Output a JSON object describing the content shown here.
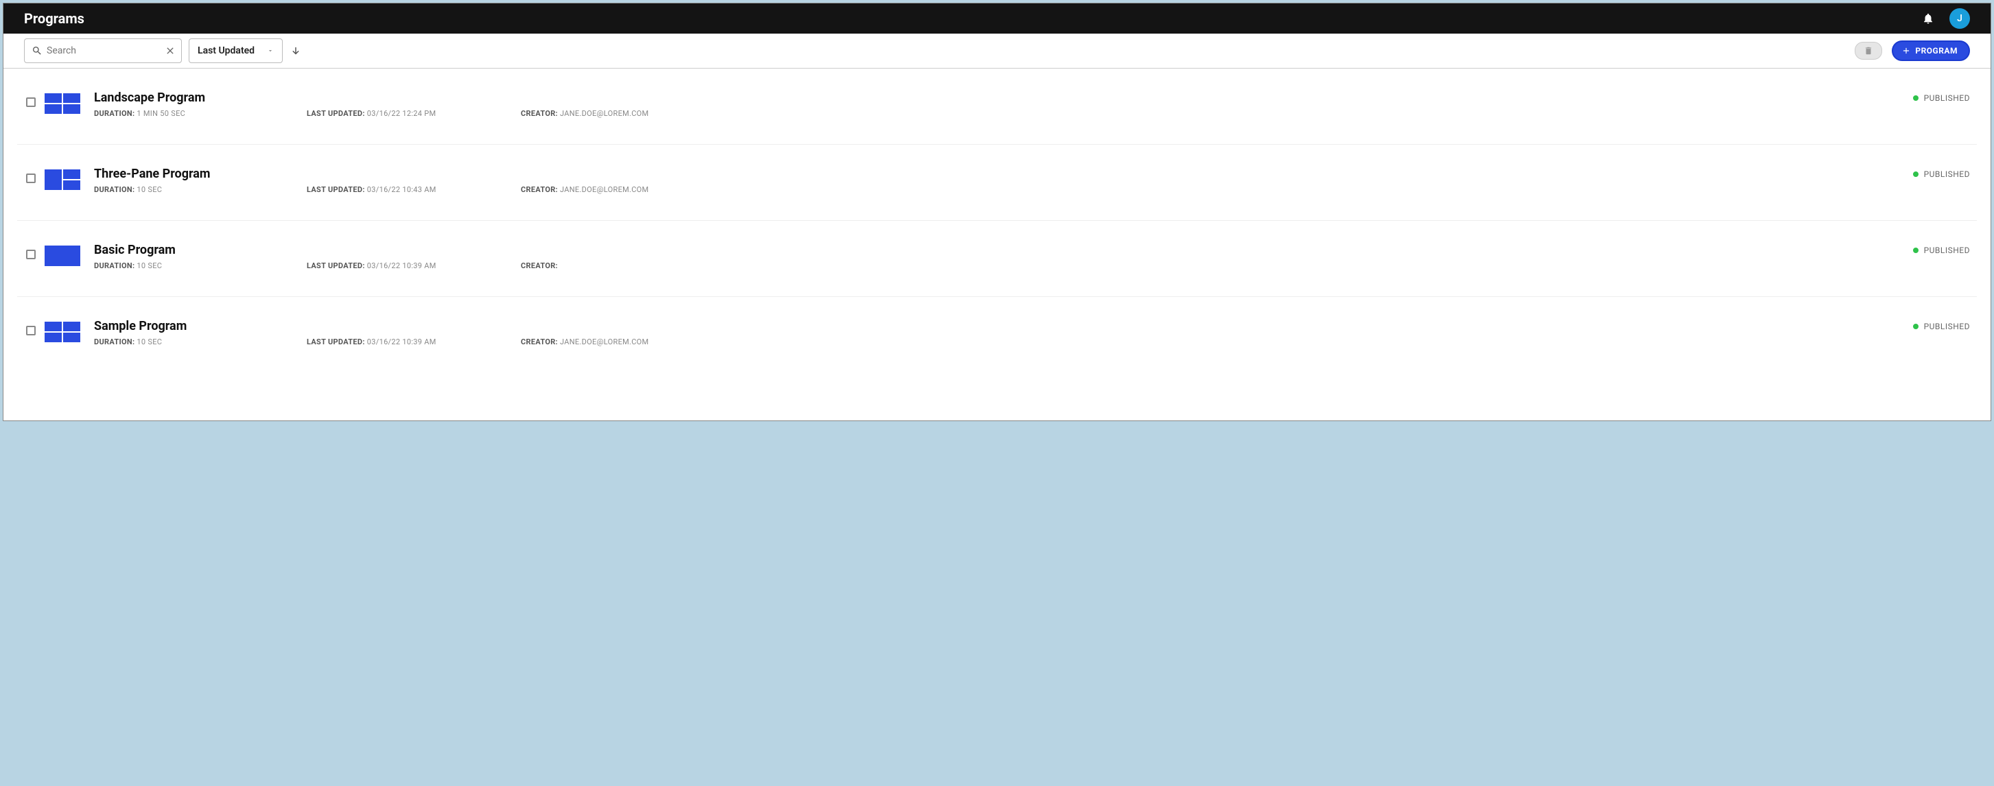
{
  "page": {
    "title": "Programs"
  },
  "header": {
    "avatar_initial": "J"
  },
  "toolbar": {
    "search_placeholder": "Search",
    "sort_label": "Last Updated",
    "add_button_label": "PROGRAM"
  },
  "labels": {
    "duration": "DURATION:",
    "last_updated": "LAST UPDATED:",
    "creator": "CREATOR:"
  },
  "programs": [
    {
      "title": "Landscape Program",
      "duration": "1 MIN 50 SEC",
      "last_updated": "03/16/22 12:24 PM",
      "creator": "JANE.DOE@LOREM.COM",
      "status": "PUBLISHED",
      "thumb_type": "grid2x2"
    },
    {
      "title": "Three-Pane Program",
      "duration": "10 SEC",
      "last_updated": "03/16/22 10:43 AM",
      "creator": "JANE.DOE@LOREM.COM",
      "status": "PUBLISHED",
      "thumb_type": "pane3"
    },
    {
      "title": "Basic Program",
      "duration": "10 SEC",
      "last_updated": "03/16/22 10:39 AM",
      "creator": "",
      "status": "PUBLISHED",
      "thumb_type": "solid"
    },
    {
      "title": "Sample Program",
      "duration": "10 SEC",
      "last_updated": "03/16/22 10:39 AM",
      "creator": "JANE.DOE@LOREM.COM",
      "status": "PUBLISHED",
      "thumb_type": "grid2x2"
    }
  ]
}
